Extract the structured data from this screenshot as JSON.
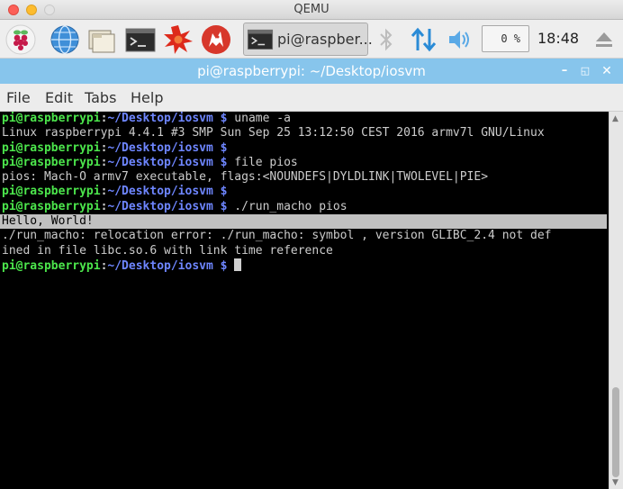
{
  "window": {
    "title": "QEMU"
  },
  "taskbar": {
    "icons": [
      "raspberry-menu-icon",
      "web-browser-icon",
      "file-manager-icon",
      "terminal-icon",
      "mathematica-icon",
      "wolfram-icon"
    ],
    "task_label": "pi@raspber...",
    "tray_icons": [
      "bluetooth-icon",
      "network-icon",
      "volume-icon"
    ],
    "cpu": "0 %",
    "clock": "18:48",
    "eject_icon": "eject-icon"
  },
  "terminal_window": {
    "title": "pi@raspberrypi: ~/Desktop/iosvm",
    "buttons": [
      "minimize",
      "maximize",
      "close"
    ]
  },
  "menu": [
    "File",
    "Edit",
    "Tabs",
    "Help"
  ],
  "terminal": {
    "prompt_user": "pi@raspberrypi",
    "prompt_colon": ":",
    "prompt_path": "~/Desktop/iosvm $",
    "lines": [
      {
        "type": "prompt",
        "cmd": " uname -a"
      },
      {
        "type": "out",
        "text": "Linux raspberrypi 4.4.1 #3 SMP Sun Sep 25 13:12:50 CEST 2016 armv7l GNU/Linux"
      },
      {
        "type": "prompt",
        "cmd": ""
      },
      {
        "type": "prompt",
        "cmd": " file pios"
      },
      {
        "type": "out",
        "text": "pios: Mach-O armv7 executable, flags:<NOUNDEFS|DYLDLINK|TWOLEVEL|PIE>"
      },
      {
        "type": "prompt",
        "cmd": ""
      },
      {
        "type": "prompt",
        "cmd": " ./run_macho pios"
      },
      {
        "type": "hl",
        "text": "Hello, World!"
      },
      {
        "type": "out",
        "text": "./run_macho: relocation error: ./run_macho: symbol , version GLIBC_2.4 not def"
      },
      {
        "type": "out",
        "text": "ined in file libc.so.6 with link time reference"
      },
      {
        "type": "prompt",
        "cmd": " ",
        "cursor": true
      }
    ]
  },
  "colors": {
    "prompt_user": "#4ce64c",
    "prompt_path": "#6e86ff",
    "titlebar": "#87c5ec",
    "terminal_bg": "#000000"
  }
}
